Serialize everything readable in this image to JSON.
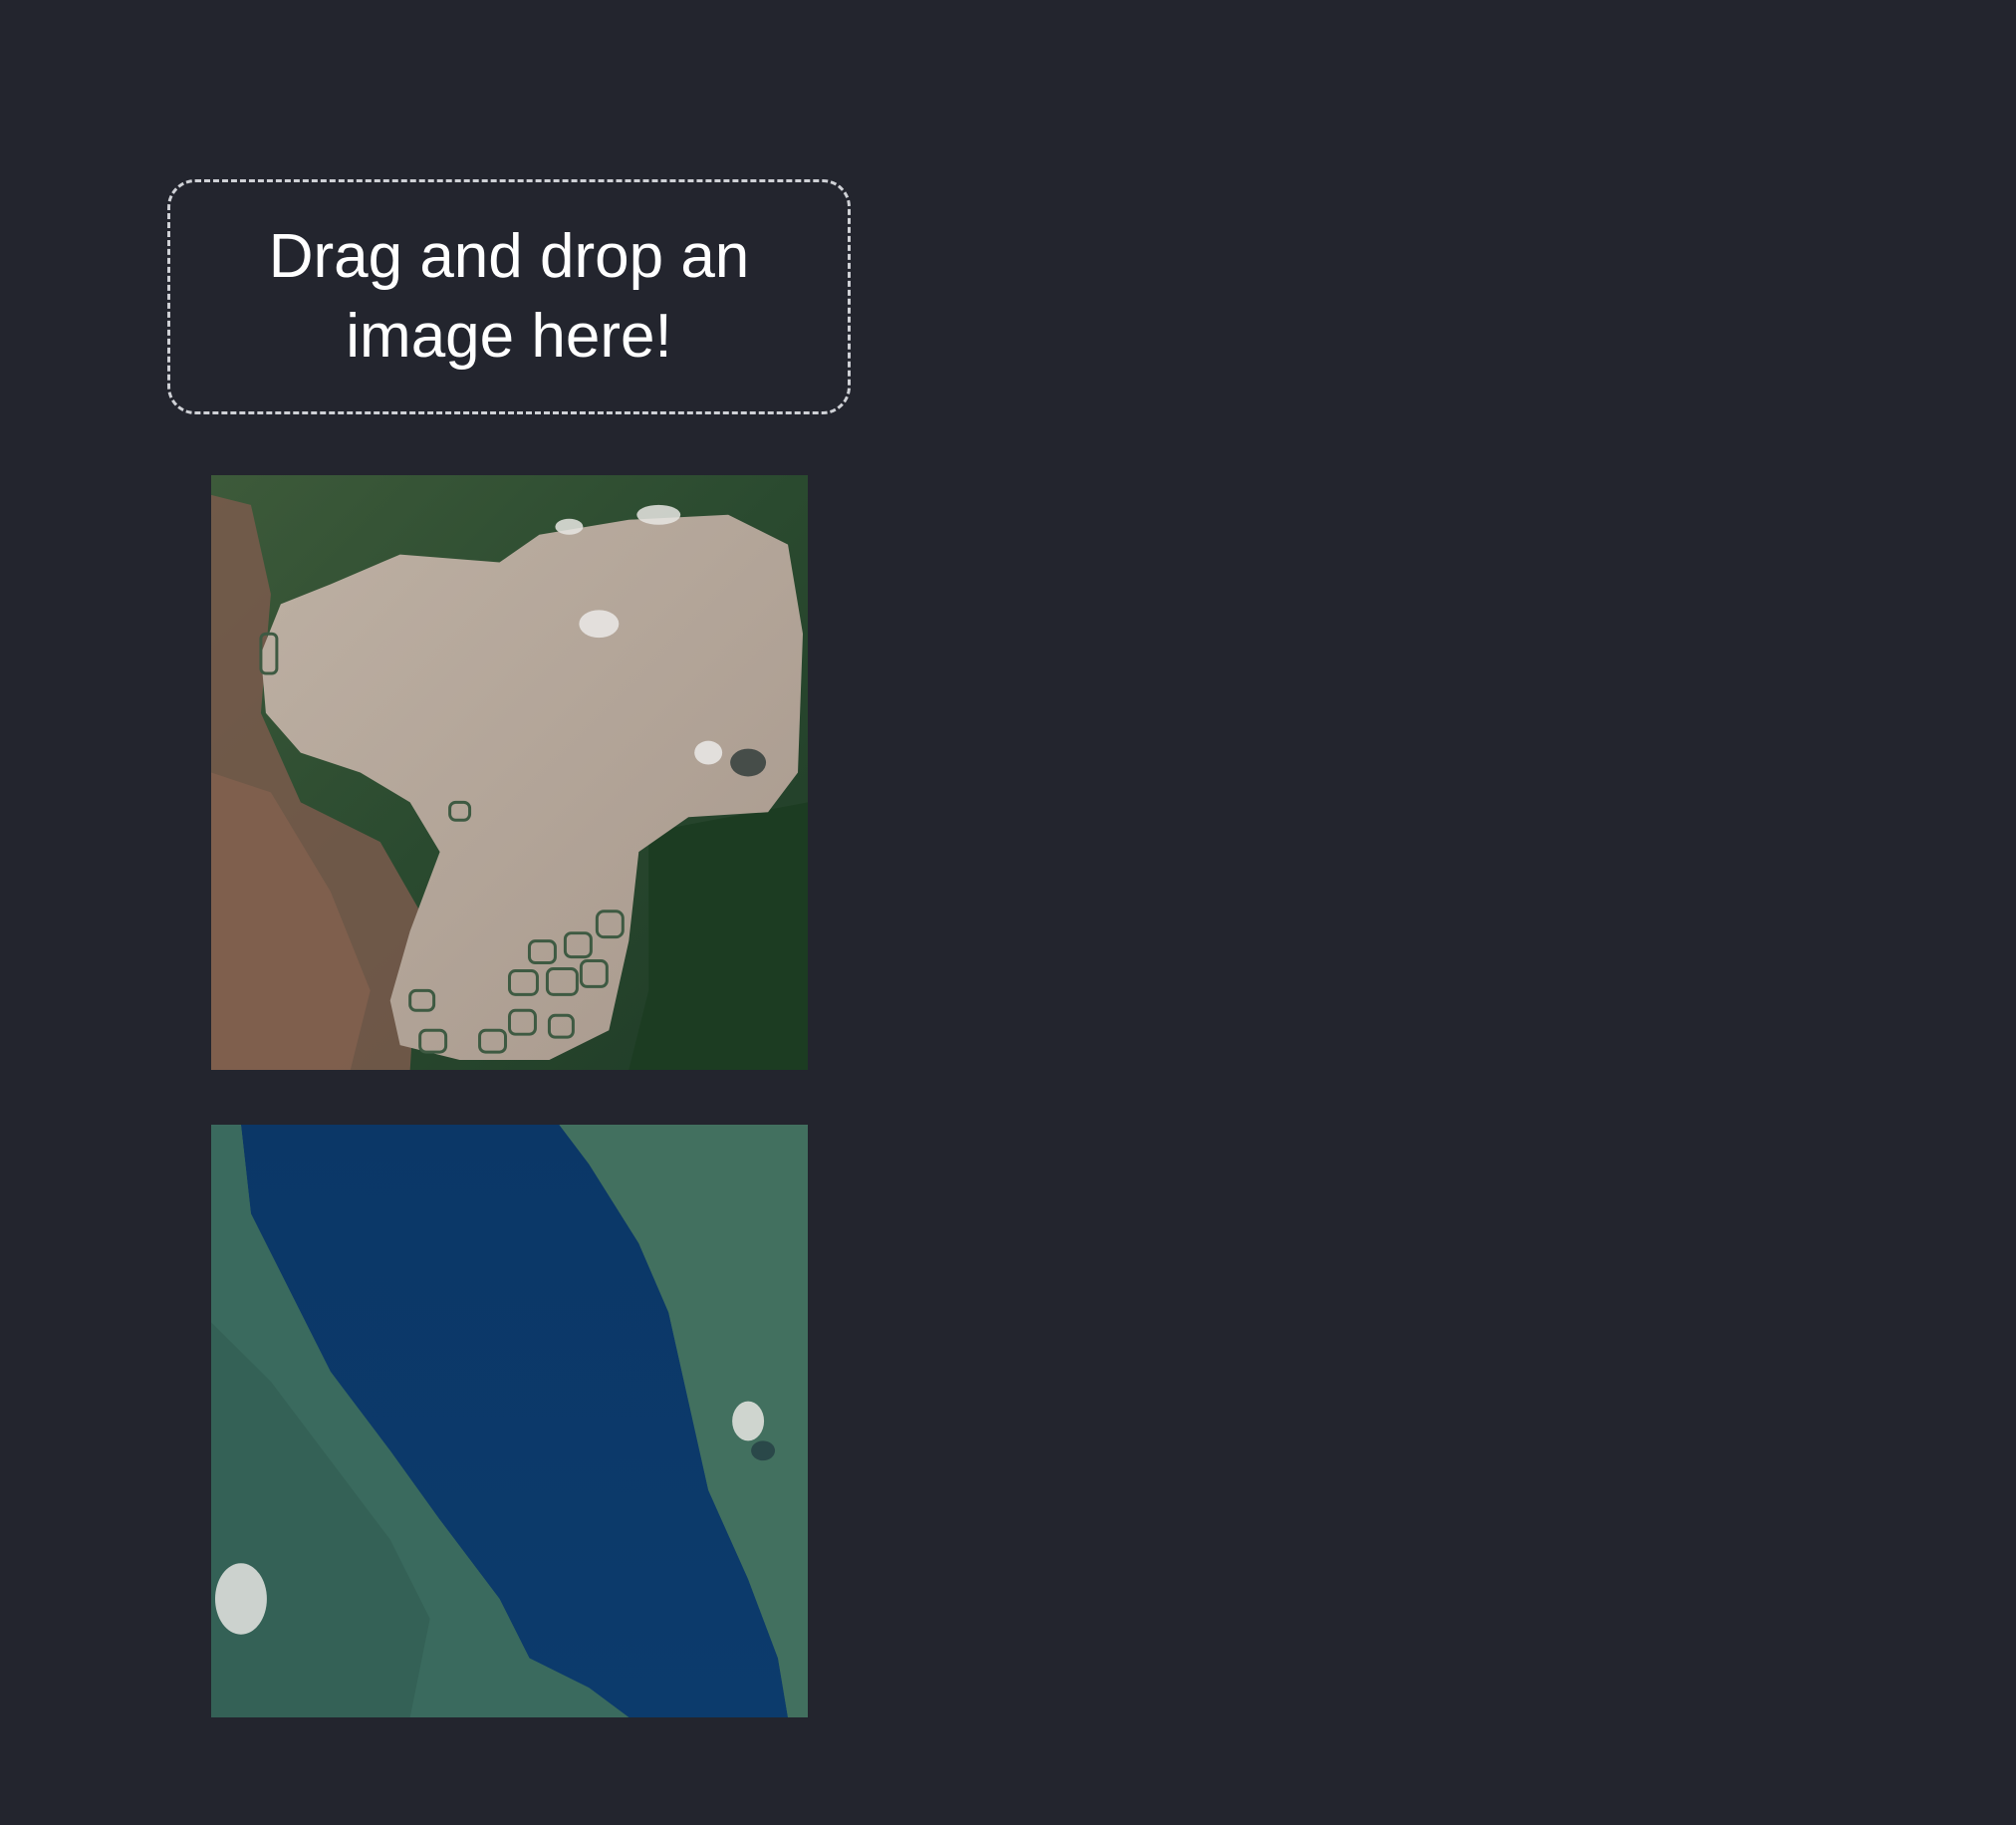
{
  "dropzone": {
    "label": "Drag and drop an image here!"
  },
  "images": [
    {
      "name": "satellite-lake-sediment",
      "dominant_color": "#b1a396"
    },
    {
      "name": "satellite-lake-blue",
      "dominant_color": "#0d3868"
    }
  ],
  "colors": {
    "background": "#23252e",
    "dropzone_border": "#cfd1d6",
    "text": "#ffffff"
  }
}
